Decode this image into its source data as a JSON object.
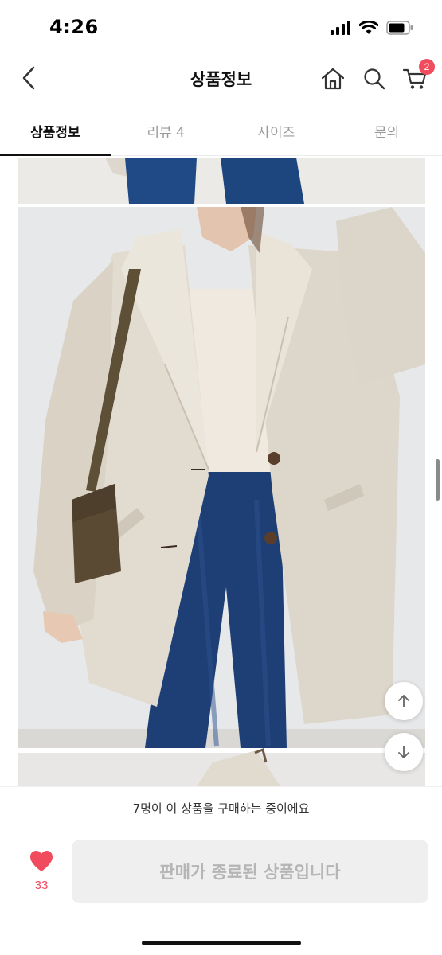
{
  "status": {
    "time": "4:26"
  },
  "header": {
    "title": "상품정보",
    "cart_count": "2"
  },
  "tabs": [
    {
      "label": "상품정보",
      "active": true
    },
    {
      "label": "리뷰 4",
      "active": false
    },
    {
      "label": "사이즈",
      "active": false
    },
    {
      "label": "문의",
      "active": false
    }
  ],
  "notice": {
    "text": "7명이 이 상품을 구매하는 중이에요"
  },
  "wishlist": {
    "count": "33"
  },
  "purchase": {
    "label": "판매가 종료된 상품입니다"
  },
  "colors": {
    "accent": "#f14b5e",
    "disabled_bg": "#efefef",
    "disabled_text": "#b5b5b5"
  },
  "icons": {
    "back": "chevron-left-icon",
    "home": "home-icon",
    "search": "search-icon",
    "cart": "cart-icon",
    "scroll_up": "arrow-up-icon",
    "scroll_down": "arrow-down-icon",
    "wish": "heart-icon"
  }
}
